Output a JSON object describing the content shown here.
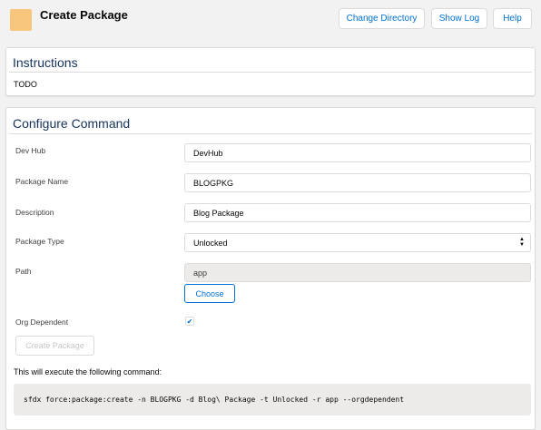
{
  "header": {
    "title": "Create Package",
    "buttons": {
      "change_directory": "Change Directory",
      "show_log": "Show Log",
      "help": "Help"
    }
  },
  "instructions": {
    "title": "Instructions",
    "body": "TODO"
  },
  "configure": {
    "title": "Configure Command",
    "dev_hub": {
      "label": "Dev Hub",
      "value": "DevHub"
    },
    "package_name": {
      "label": "Package Name",
      "value": "BLOGPKG"
    },
    "description": {
      "label": "Description",
      "value": "Blog Package"
    },
    "package_type": {
      "label": "Package Type",
      "value": "Unlocked"
    },
    "path": {
      "label": "Path",
      "value": "app",
      "choose_label": "Choose"
    },
    "org_dependent": {
      "label": "Org Dependent",
      "checked": true,
      "check_glyph": "✔"
    },
    "create_button": "Create Package",
    "exec_text": "This will execute the following command:",
    "command": "sfdx force:package:create -n BLOGPKG -d Blog\\ Package -t Unlocked -r app --orgdependent"
  },
  "colors": {
    "brand": "#0070d2",
    "logo": "#f7c57b",
    "background": "#f3f2f2"
  }
}
